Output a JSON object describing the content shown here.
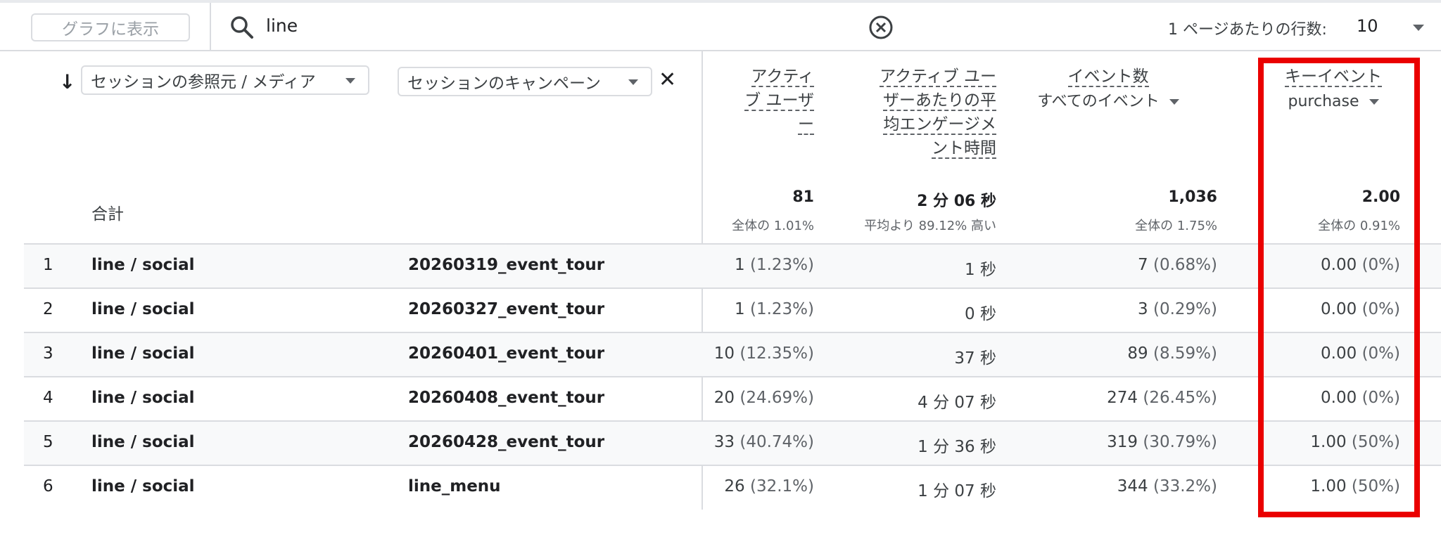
{
  "toolbar": {
    "graph_button": "グラフに表示",
    "search_value": "line",
    "rows_label": "1 ページあたりの行数:",
    "rows_value": "10"
  },
  "dimensions": {
    "primary": "セッションの参照元 / メディア",
    "secondary": "セッションのキャンペーン"
  },
  "metrics": {
    "active_users": [
      "アクティ",
      "ブ ユーザ",
      "ー"
    ],
    "avg_engagement": [
      "アクティブ ユー",
      "ザーあたりの平",
      "均エンゲージメ",
      "ント時間"
    ],
    "event_count": "イベント数",
    "event_count_filter": "すべてのイベント",
    "key_events": "キーイベント",
    "key_events_filter": "purchase"
  },
  "totals": {
    "label": "合計",
    "active_users": "81",
    "active_users_sub": "全体の 1.01%",
    "avg_engagement": "2 分 06 秒",
    "avg_engagement_sub": "平均より 89.12% 高い",
    "event_count": "1,036",
    "event_count_sub": "全体の 1.75%",
    "key_events": "2.00",
    "key_events_sub": "全体の 0.91%"
  },
  "rows": [
    {
      "num": "1",
      "source": "line / social",
      "campaign": "20260319_event_tour",
      "users": "1",
      "users_pct": "(1.23%)",
      "eng": "1 秒",
      "events": "7",
      "events_pct": "(0.68%)",
      "key": "0.00",
      "key_pct": "(0%)"
    },
    {
      "num": "2",
      "source": "line / social",
      "campaign": "20260327_event_tour",
      "users": "1",
      "users_pct": "(1.23%)",
      "eng": "0 秒",
      "events": "3",
      "events_pct": "(0.29%)",
      "key": "0.00",
      "key_pct": "(0%)"
    },
    {
      "num": "3",
      "source": "line / social",
      "campaign": "20260401_event_tour",
      "users": "10",
      "users_pct": "(12.35%)",
      "eng": "37 秒",
      "events": "89",
      "events_pct": "(8.59%)",
      "key": "0.00",
      "key_pct": "(0%)"
    },
    {
      "num": "4",
      "source": "line / social",
      "campaign": "20260408_event_tour",
      "users": "20",
      "users_pct": "(24.69%)",
      "eng": "4 分 07 秒",
      "events": "274",
      "events_pct": "(26.45%)",
      "key": "0.00",
      "key_pct": "(0%)"
    },
    {
      "num": "5",
      "source": "line / social",
      "campaign": "20260428_event_tour",
      "users": "33",
      "users_pct": "(40.74%)",
      "eng": "1 分 36 秒",
      "events": "319",
      "events_pct": "(30.79%)",
      "key": "1.00",
      "key_pct": "(50%)"
    },
    {
      "num": "6",
      "source": "line / social",
      "campaign": "line_menu",
      "users": "26",
      "users_pct": "(32.1%)",
      "eng": "1 分 07 秒",
      "events": "344",
      "events_pct": "(33.2%)",
      "key": "1.00",
      "key_pct": "(50%)"
    }
  ],
  "colors": {
    "highlight": "#ea0000",
    "divider": "#dadce0",
    "alt_row": "#f8f9fa"
  },
  "icons": [
    "search-icon",
    "clear-circle-icon",
    "dropdown-caret-icon",
    "sort-down-arrow-icon",
    "close-icon"
  ]
}
